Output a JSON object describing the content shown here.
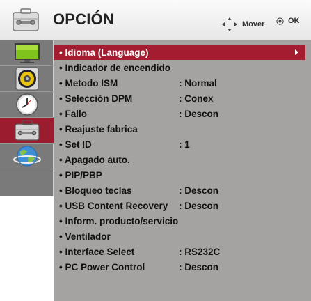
{
  "header": {
    "title": "OPCIÓN",
    "move_label": "Mover",
    "ok_label": "OK"
  },
  "sidebar": {
    "tabs": [
      {
        "name": "picture",
        "icon": "monitor-icon"
      },
      {
        "name": "audio",
        "icon": "speaker-icon"
      },
      {
        "name": "time",
        "icon": "clock-icon"
      },
      {
        "name": "option",
        "icon": "toolbox-icon",
        "selected": true
      },
      {
        "name": "network",
        "icon": "globe-icon"
      }
    ]
  },
  "menu": {
    "items": [
      {
        "label": "• Idioma (Language)",
        "value": "",
        "selected": true
      },
      {
        "label": "• Indicador de encendido",
        "value": ""
      },
      {
        "label": "• Metodo ISM",
        "value": ": Normal"
      },
      {
        "label": "• Selección DPM",
        "value": ": Conex"
      },
      {
        "label": "• Fallo",
        "value": ": Descon"
      },
      {
        "label": "• Reajuste fabrica",
        "value": ""
      },
      {
        "label": "• Set ID",
        "value": ": 1"
      },
      {
        "label": "• Apagado auto.",
        "value": ""
      },
      {
        "label": "• PIP/PBP",
        "value": ""
      },
      {
        "label": "• Bloqueo teclas",
        "value": ": Descon"
      },
      {
        "label": "• USB Content Recovery",
        "value": ": Descon"
      },
      {
        "label": "• Inform. producto/servicio",
        "value": ""
      },
      {
        "label": "• Ventilador",
        "value": ""
      },
      {
        "label": "• Interface Select",
        "value": ": RS232C"
      },
      {
        "label": "• PC Power Control",
        "value": ": Descon"
      }
    ]
  },
  "colors": {
    "accent": "#a31c2f",
    "panel": "#a4a3a1",
    "sidebar": "#7a7a7a"
  }
}
